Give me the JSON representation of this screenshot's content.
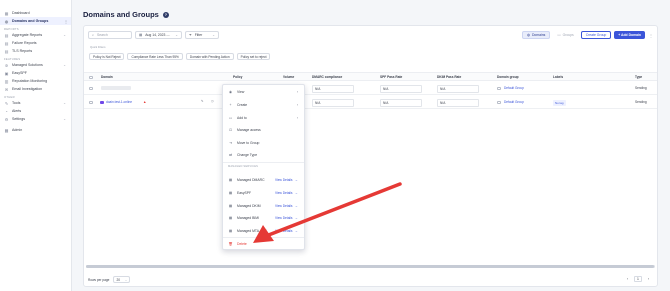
{
  "sidebar": {
    "items_top": [
      {
        "label": "Dashboard",
        "icon": "grid-icon"
      },
      {
        "label": "Domains and Groups",
        "icon": "globe-icon",
        "active": true
      }
    ],
    "reports_title": "REPORTS",
    "reports": [
      {
        "label": "Aggregate Reports",
        "chevron": true
      },
      {
        "label": "Failure Reports"
      },
      {
        "label": "TLS Reports"
      }
    ],
    "features_title": "FEATURES",
    "features": [
      {
        "label": "Managed Solutions",
        "chevron": true
      },
      {
        "label": "EasySPF"
      },
      {
        "label": "Reputation Monitoring"
      },
      {
        "label": "Email Investigation"
      }
    ],
    "other_title": "OTHER",
    "other": [
      {
        "label": "Tools",
        "chevron": true
      },
      {
        "label": "Alerts"
      },
      {
        "label": "Settings",
        "chevron": true
      }
    ],
    "admin": {
      "label": "Admin"
    }
  },
  "header": {
    "title": "Domains and Groups",
    "help": "?"
  },
  "toolbar": {
    "search_placeholder": "Search",
    "date_range": "Aug 14, 2023 -...",
    "filter_label": "Filter",
    "domains_label": "Domains",
    "groups_label": "Groups",
    "create_group_label": "Create Group",
    "add_domain_label": "+ Add Domain"
  },
  "quick_filters": {
    "label": "Quick Filters",
    "chips": [
      "Policy is Not Reject",
      "Compliance Rate Less Than 95%",
      "Domain with Pending Action",
      "Policy set to reject"
    ]
  },
  "table": {
    "columns": [
      "Domain",
      "Policy",
      "Volume",
      "DMARC compliance",
      "SPF Pass Rate",
      "DKIM Pass Rate",
      "Domain group",
      "Labels",
      "Type"
    ],
    "rows": [
      {
        "domain": "",
        "dmarc": "N/A",
        "spf": "N/A",
        "dkim": "N/A",
        "group": "Default Group",
        "label": "",
        "type": "Sending"
      },
      {
        "domain": "doain.test-1.online",
        "dmarc": "N/A",
        "spf": "N/A",
        "dkim": "N/A",
        "group": "Default Group",
        "label": "No tag",
        "type": "Sending"
      }
    ]
  },
  "footer": {
    "rows_per_page_label": "Rows per page",
    "rows_per_page": "20",
    "page": "1"
  },
  "context_menu": {
    "items": [
      {
        "label": "View",
        "icon": "eye-icon",
        "chevron": true
      },
      {
        "label": "Create",
        "icon": "plus-icon",
        "chevron": true
      },
      {
        "label": "Add to",
        "icon": "folder-icon",
        "chevron": true
      },
      {
        "label": "Manage access",
        "icon": "lock-icon"
      },
      {
        "label": "Move to Group",
        "icon": "move-icon"
      },
      {
        "label": "Change Type",
        "icon": "swap-icon"
      }
    ],
    "managed_title": "MANAGED SERVICES",
    "managed": [
      {
        "label": "Managed DMARC",
        "link": "View Details"
      },
      {
        "label": "EasySPF",
        "link": "View Details"
      },
      {
        "label": "Managed DKIM",
        "link": "View Details"
      },
      {
        "label": "Managed BIMI",
        "link": "View Details"
      },
      {
        "label": "Managed MTA-STS",
        "link": "View Details"
      }
    ],
    "delete_label": "Delete"
  },
  "annotation": {
    "arrow_color": "#e53935"
  }
}
